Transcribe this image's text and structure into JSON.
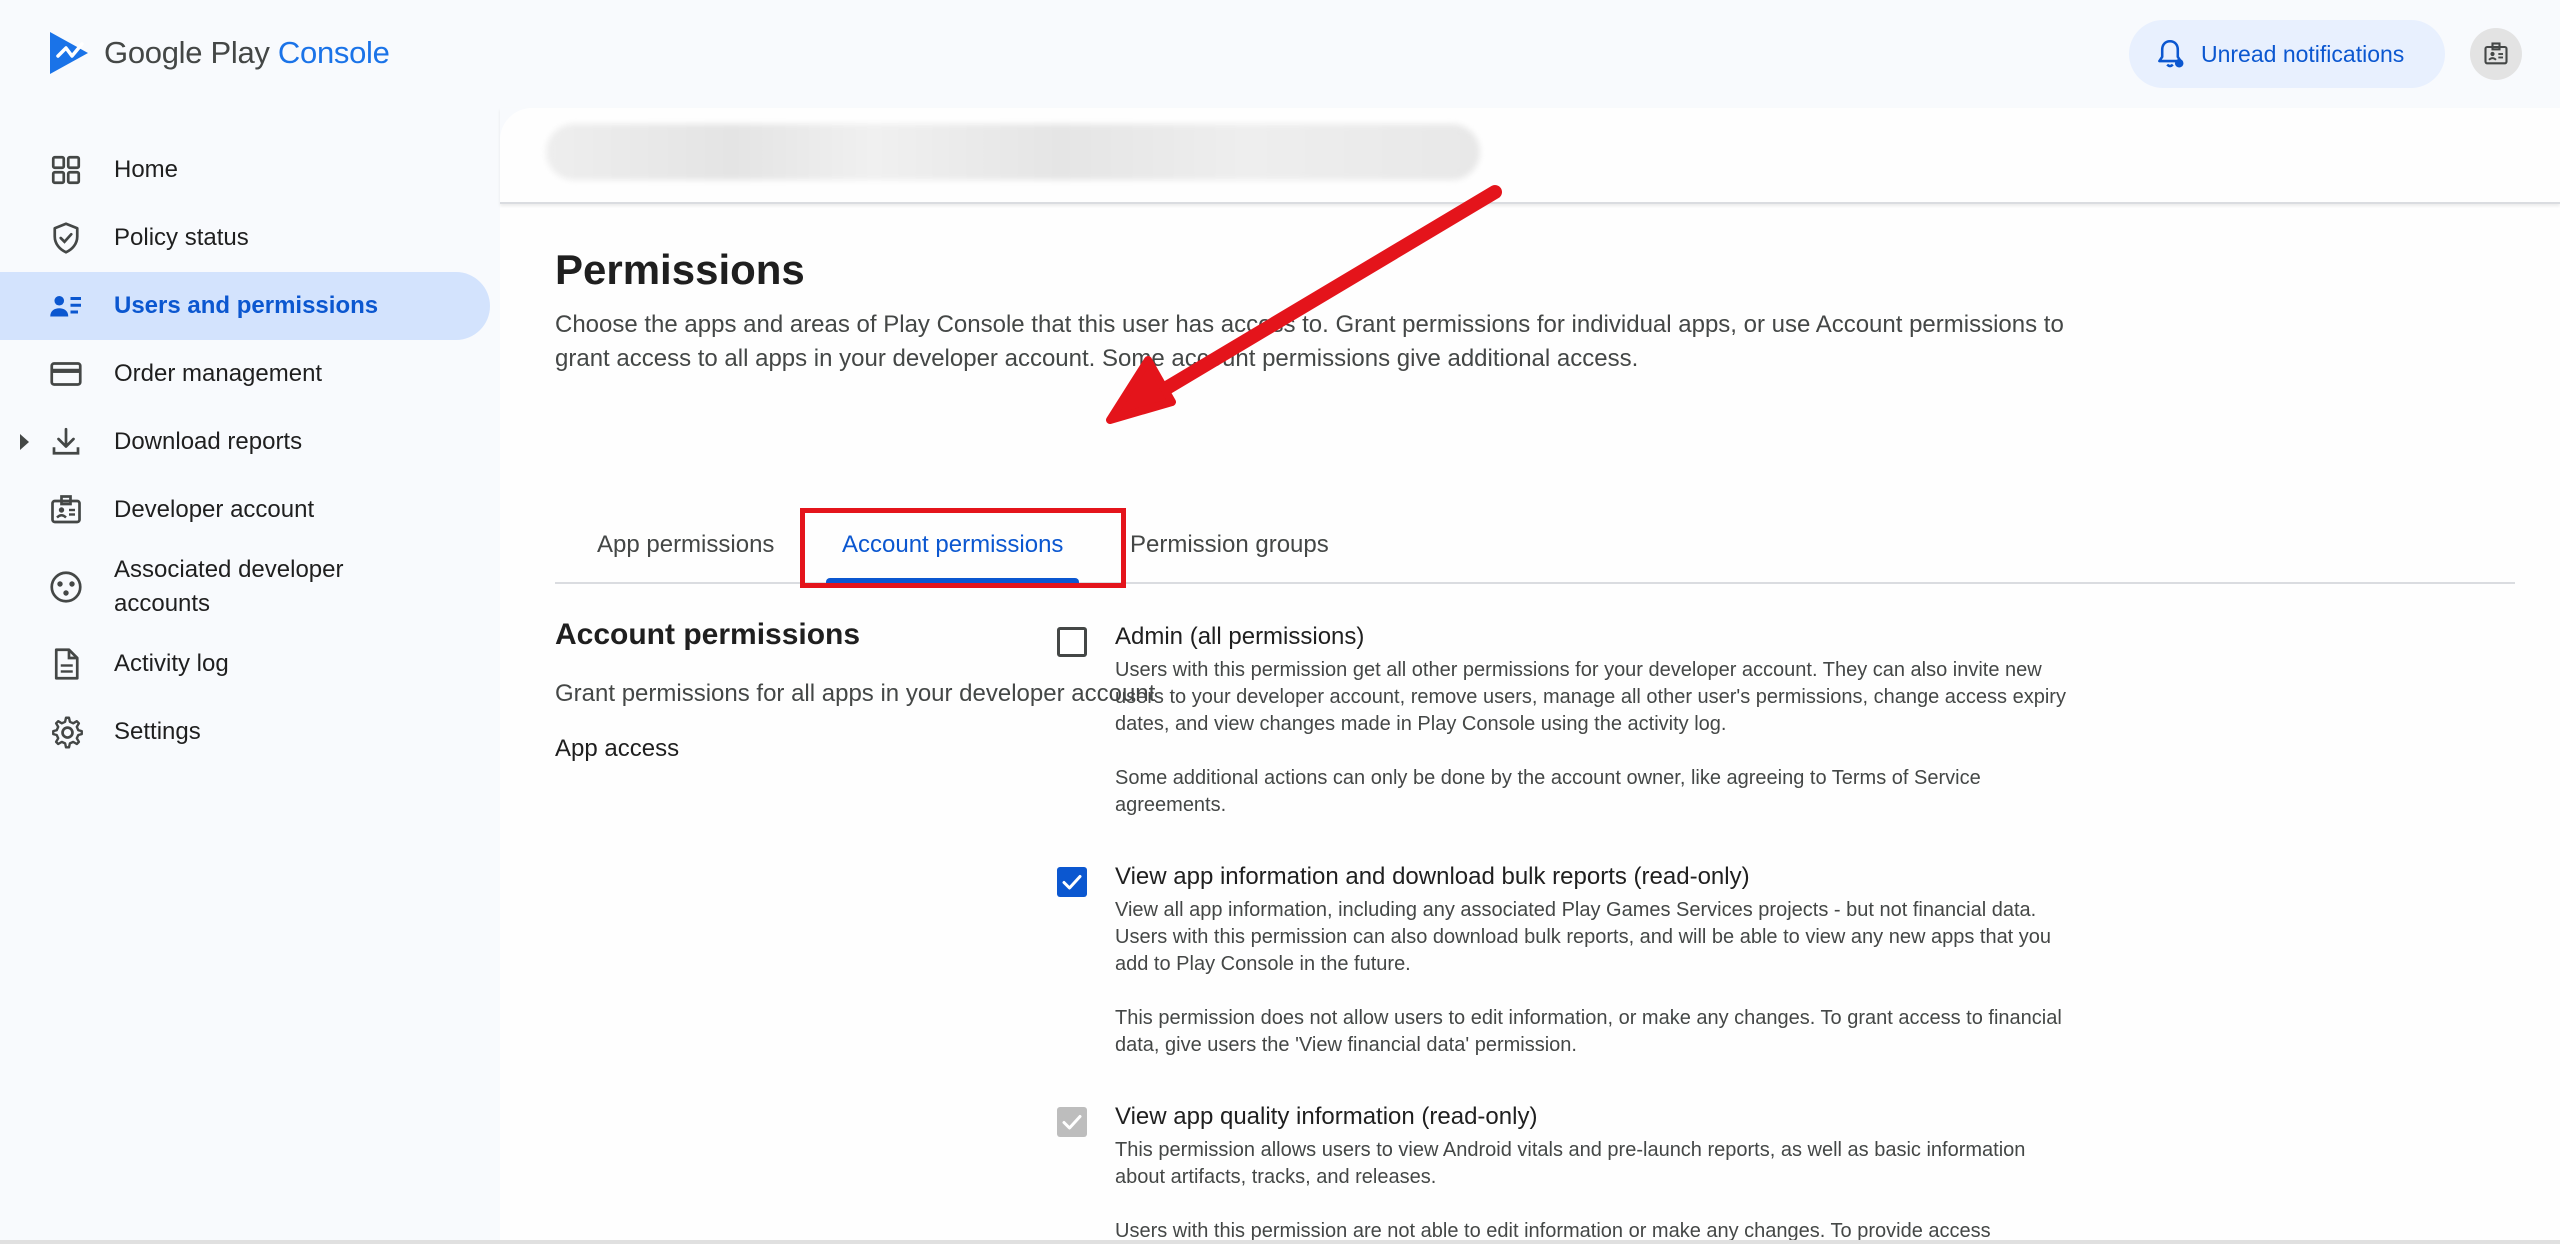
{
  "brand": {
    "name_part1": "Google Play",
    "name_part2": "Console"
  },
  "header": {
    "notifications_label": "Unread notifications"
  },
  "sidebar": {
    "items": [
      {
        "label": "Home",
        "icon": "grid-icon"
      },
      {
        "label": "Policy status",
        "icon": "shield-check-icon"
      },
      {
        "label": "Users and permissions",
        "icon": "users-list-icon",
        "active": true
      },
      {
        "label": "Order management",
        "icon": "credit-card-icon"
      },
      {
        "label": "Download reports",
        "icon": "download-icon",
        "expandable": true
      },
      {
        "label": "Developer account",
        "icon": "id-badge-icon"
      },
      {
        "label": "Associated developer accounts",
        "icon": "linked-accounts-icon"
      },
      {
        "label": "Activity log",
        "icon": "document-icon"
      },
      {
        "label": "Settings",
        "icon": "gear-icon"
      }
    ]
  },
  "page": {
    "title": "Permissions",
    "description": "Choose the apps and areas of Play Console that this user has access to. Grant permissions for individual apps, or use Account permissions to grant access to all apps in your developer account. Some account permissions give additional access.",
    "tabs": [
      {
        "label": "App permissions",
        "active": false
      },
      {
        "label": "Account permissions",
        "active": true
      },
      {
        "label": "Permission groups",
        "active": false
      }
    ]
  },
  "section": {
    "title": "Account permissions",
    "subtitle": "Grant permissions for all apps in your developer account",
    "row_label": "App access",
    "permissions": [
      {
        "title": "Admin (all permissions)",
        "state": "unchecked",
        "paragraphs": [
          "Users with this permission get all other permissions for your developer account. They can also invite new users to your developer account, remove users, manage all other user's permissions, change access expiry dates, and view changes made in Play Console using the activity log.",
          "Some additional actions can only be done by the account owner, like agreeing to Terms of Service agreements."
        ]
      },
      {
        "title": "View app information and download bulk reports (read-only)",
        "state": "checked",
        "paragraphs": [
          "View all app information, including any associated Play Games Services projects - but not financial data. Users with this permission can also download bulk reports, and will be able to view any new apps that you add to Play Console in the future.",
          "This permission does not allow users to edit information, or make any changes. To grant access to financial data, give users the 'View financial data' permission."
        ]
      },
      {
        "title": "View app quality information (read-only)",
        "state": "checked-disabled",
        "paragraphs": [
          "This permission allows users to view Android vitals and pre-launch reports, as well as basic information about artifacts, tracks, and releases.",
          "Users with this permission are not able to edit information or make any changes. To provide access"
        ]
      }
    ]
  },
  "colors": {
    "accent": "#0b57d0",
    "annotation": "#e4141b",
    "active_nav_bg": "#d3e3fd"
  }
}
